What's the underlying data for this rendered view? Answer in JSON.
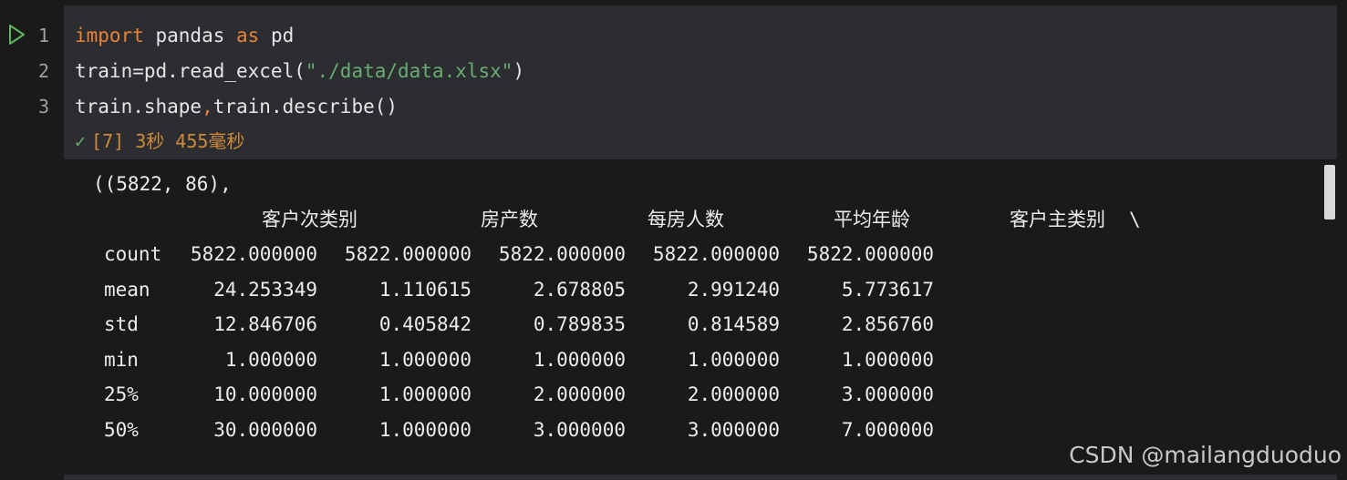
{
  "editor": {
    "line_numbers": [
      "1",
      "2",
      "3"
    ],
    "code": {
      "line1": {
        "kw1": "import",
        "mid": " pandas ",
        "kw2": "as",
        "end": " pd"
      },
      "line2": {
        "start": "train=pd.read_excel(",
        "str": "\"./data/data.xlsx\"",
        "end": ")"
      },
      "line3": {
        "start": "train.shape",
        "comma": ",",
        "end": "train.describe()"
      }
    },
    "exec_status": {
      "check": "✓",
      "text": "[7] 3秒 455毫秒"
    }
  },
  "output": {
    "shape_line": "((5822, 86),",
    "columns": [
      "客户次类别",
      "房产数",
      "每房人数",
      "平均年龄",
      "客户主类别"
    ],
    "continuation": "\\",
    "rows": [
      {
        "label": "count",
        "values": [
          "5822.000000",
          "5822.000000",
          "5822.000000",
          "5822.000000",
          "5822.000000"
        ]
      },
      {
        "label": "mean",
        "values": [
          "24.253349",
          "1.110615",
          "2.678805",
          "2.991240",
          "5.773617"
        ]
      },
      {
        "label": "std",
        "values": [
          "12.846706",
          "0.405842",
          "0.789835",
          "0.814589",
          "2.856760"
        ]
      },
      {
        "label": "min",
        "values": [
          "1.000000",
          "1.000000",
          "1.000000",
          "1.000000",
          "1.000000"
        ]
      },
      {
        "label": "25%",
        "values": [
          "10.000000",
          "1.000000",
          "2.000000",
          "2.000000",
          "3.000000"
        ]
      },
      {
        "label": "50%",
        "values": [
          "30.000000",
          "1.000000",
          "3.000000",
          "3.000000",
          "7.000000"
        ]
      }
    ]
  },
  "watermark": "CSDN @mailangduoduo",
  "colors": {
    "background": "#1a1a1a",
    "cell_background": "#2b2d30",
    "keyword": "#e8823a",
    "string": "#6aab73",
    "status": "#d08a3a",
    "run_icon": "#5fb85f"
  },
  "icons": {
    "run": "run-triangle-icon",
    "check": "check-icon"
  }
}
